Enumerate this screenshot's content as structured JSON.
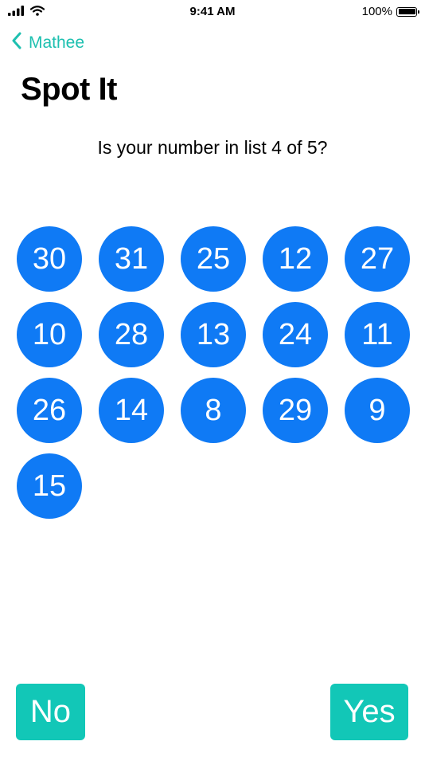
{
  "status_bar": {
    "time": "9:41 AM",
    "battery": "100%",
    "battery_level": 1.0,
    "signal_icon": "signal-bars-icon",
    "wifi_icon": "wifi-icon",
    "battery_icon": "battery-icon"
  },
  "nav": {
    "back_label": "Mathee",
    "back_icon": "chevron-left-icon",
    "accent_color": "#1ec0b0"
  },
  "title": "Spot It",
  "question": "Is your number in list 4 of 5?",
  "numbers": [
    "30",
    "31",
    "25",
    "12",
    "27",
    "10",
    "28",
    "13",
    "24",
    "11",
    "26",
    "14",
    "8",
    "29",
    "9",
    "15"
  ],
  "colors": {
    "number_circle": "#0f7af5",
    "answer_button": "#12c7b7"
  },
  "buttons": {
    "no_label": "No",
    "yes_label": "Yes"
  }
}
